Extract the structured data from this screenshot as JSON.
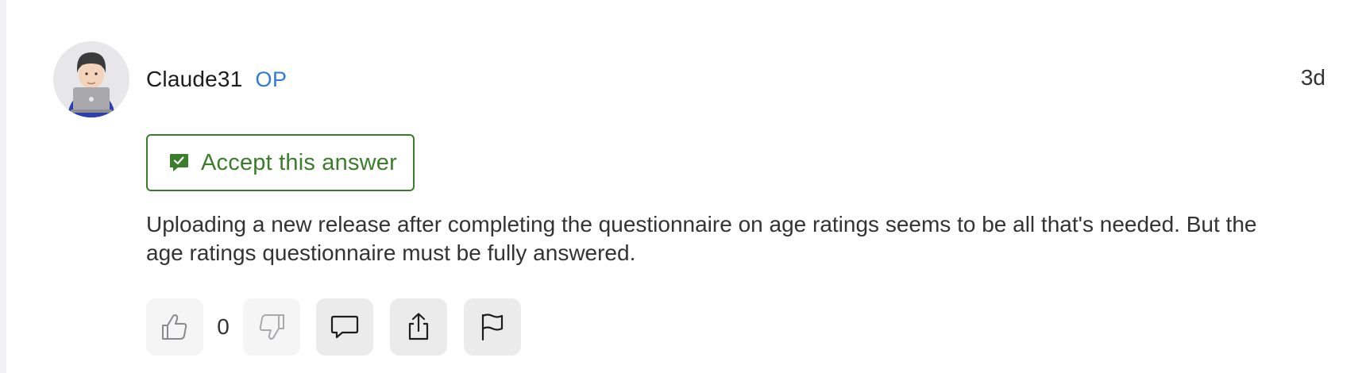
{
  "post": {
    "author": "Claude31",
    "author_badge": "OP",
    "timestamp": "3d",
    "avatar_icon": "person-with-laptop-icon",
    "accept_label": "Accept this answer",
    "accept_icon": "checkmark-speech-bubble-icon",
    "body": "Uploading a new release after completing the questionnaire on age ratings seems to be all that's needed. But the age ratings questionnaire must be fully answered.",
    "vote_count": "0",
    "actions": {
      "upvote_icon": "thumbs-up-icon",
      "downvote_icon": "thumbs-down-icon",
      "reply_icon": "comment-bubble-icon",
      "share_icon": "share-icon",
      "flag_icon": "flag-icon"
    }
  },
  "colors": {
    "accept_green": "#3a7d2a",
    "op_blue": "#2f7bd9",
    "button_bg": "#ebebeb"
  }
}
